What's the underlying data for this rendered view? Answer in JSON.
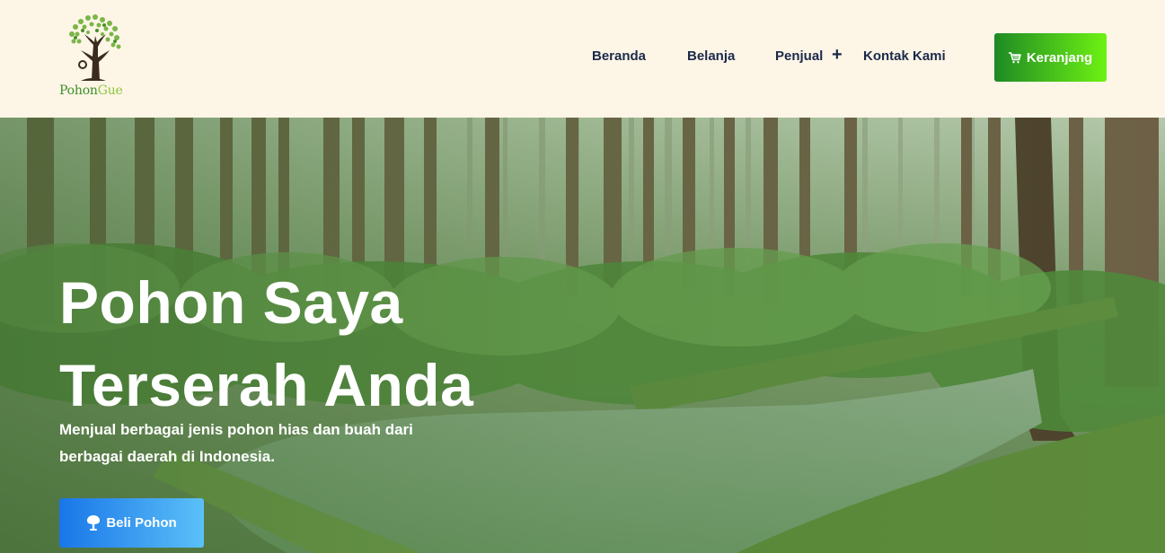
{
  "brand": {
    "name_part1": "Pohon",
    "name_part2": "Gue",
    "logo_icon": "tree-logo-icon",
    "colors": {
      "primary": "#3d8f2a",
      "secondary": "#8cc63f"
    }
  },
  "nav": {
    "items": [
      {
        "label": "Beranda"
      },
      {
        "label": "Belanja"
      },
      {
        "label": "Penjual"
      },
      {
        "label": "Kontak Kami"
      }
    ],
    "expand_icon": "plus-icon"
  },
  "cart": {
    "label": "Keranjang",
    "icon": "cart-icon",
    "colors": {
      "from": "#1e8a24",
      "to": "#6ef213"
    }
  },
  "hero": {
    "title_line1": "Pohon Saya",
    "title_line2": "Terserah Anda",
    "subtitle": "Menjual berbagai jenis pohon hias dan buah dari berbagai daerah di Indonesia.",
    "cta_label": "Beli Pohon",
    "cta_icon": "tree-icon",
    "cta_colors": {
      "from": "#1976e8",
      "to": "#5bc0f8"
    }
  },
  "colors": {
    "header_bg": "#fdf5e6",
    "nav_text": "#1b2a4a"
  }
}
